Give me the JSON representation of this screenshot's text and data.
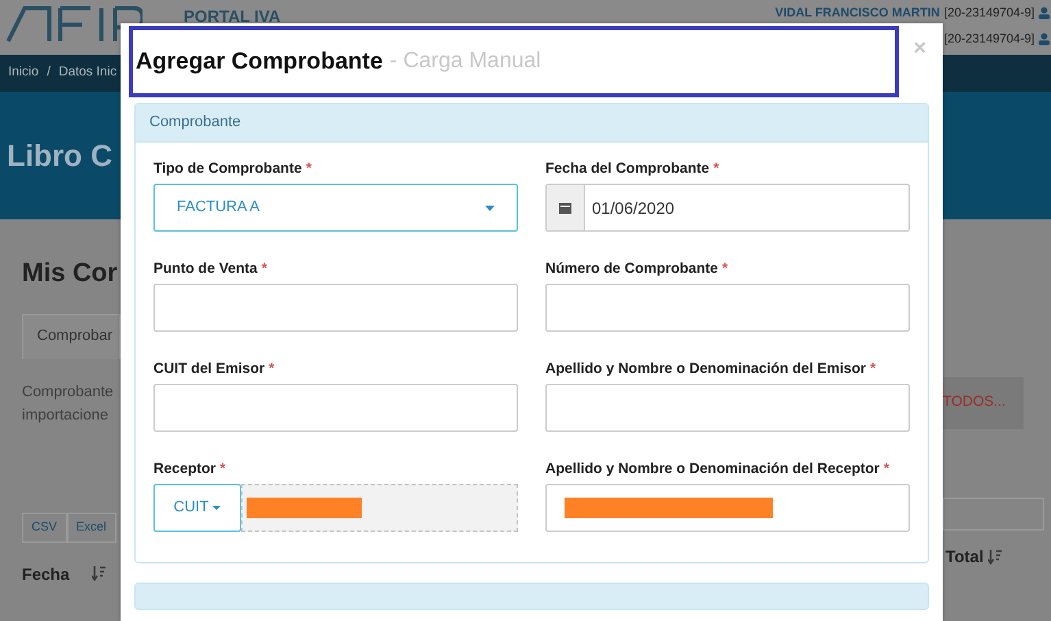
{
  "header": {
    "portal": "PORTAL IVA",
    "user_name": "VIDAL FRANCISCO MARTIN",
    "user_cuit": "[20-23149704-9]",
    "user_cuit_2": "[20-23149704-9]"
  },
  "breadcrumb": {
    "home": "Inicio",
    "separator": "/",
    "current": "Datos Inic"
  },
  "page_title": "Libro C",
  "section_title": "Mis Cor",
  "tab": "Comprobar",
  "description": [
    "Comprobante",
    "importacione"
  ],
  "action_button": "TODOS...",
  "export_buttons": [
    "CSV",
    "Excel"
  ],
  "columns": [
    "Fecha",
    "Total"
  ],
  "modal": {
    "title": "Agregar Comprobante",
    "subtitle": "- Carga Manual",
    "close": "×",
    "panel_title": "Comprobante",
    "fields": [
      {
        "kind": "select",
        "label": "Tipo de Comprobante",
        "mark": "*",
        "value": "FACTURA A"
      },
      {
        "kind": "date",
        "label": "Fecha del Comprobante",
        "mark": "*",
        "value": "01/06/2020"
      },
      {
        "kind": "text",
        "label": "Punto de Venta",
        "mark": "*"
      },
      {
        "kind": "text",
        "label": "Número de Comprobante",
        "mark": "*"
      },
      {
        "kind": "text",
        "label": "CUIT del Emisor",
        "mark": "*"
      },
      {
        "kind": "text",
        "label": "Apellido y Nombre o Denominación del Emisor",
        "mark": "*"
      },
      {
        "kind": "document",
        "label": "Receptor",
        "mark": "*",
        "doc_type": "CUIT",
        "redacted": true,
        "disabled": true
      },
      {
        "kind": "text",
        "label": "Apellido y Nombre o Denominación del Receptor",
        "mark": "*",
        "redacted": true
      }
    ]
  }
}
